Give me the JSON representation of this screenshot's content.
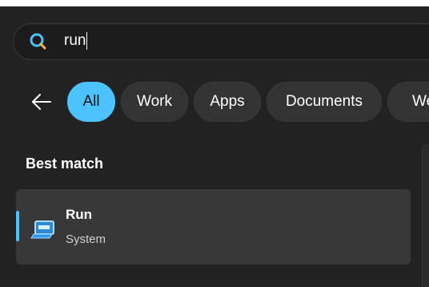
{
  "search": {
    "query": "run",
    "icon": "search-icon"
  },
  "filters": {
    "back_icon": "back-arrow-icon",
    "items": [
      {
        "label": "All",
        "active": true
      },
      {
        "label": "Work",
        "active": false
      },
      {
        "label": "Apps",
        "active": false
      },
      {
        "label": "Documents",
        "active": false
      },
      {
        "label": "Web",
        "active": false
      }
    ],
    "accent_color": "#4cc2ff"
  },
  "results": {
    "section_title": "Best match",
    "best_match": {
      "title": "Run",
      "subtitle": "System",
      "icon": "run-app-icon"
    }
  }
}
